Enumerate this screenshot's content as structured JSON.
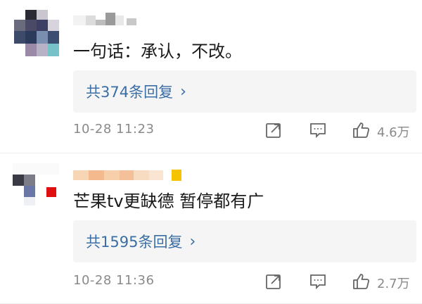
{
  "comments": [
    {
      "text": "一句话：承认，不改。",
      "reply_link": "共374条回复",
      "timestamp": "10-28 11:23",
      "like_count": "4.6万"
    },
    {
      "text": "芒果tv更缺德 暂停都有广",
      "reply_link": "共1595条回复",
      "timestamp": "10-28 11:36",
      "like_count": "2.7万"
    }
  ],
  "icons": {
    "share": "share-icon",
    "comment": "comment-icon",
    "like": "thumbs-up-icon",
    "reply_chevron": "chevron-right-icon"
  },
  "colors": {
    "link_blue": "#3a6ea5",
    "meta_gray": "#8a8a8a",
    "reply_bg": "#f5f5f5"
  }
}
